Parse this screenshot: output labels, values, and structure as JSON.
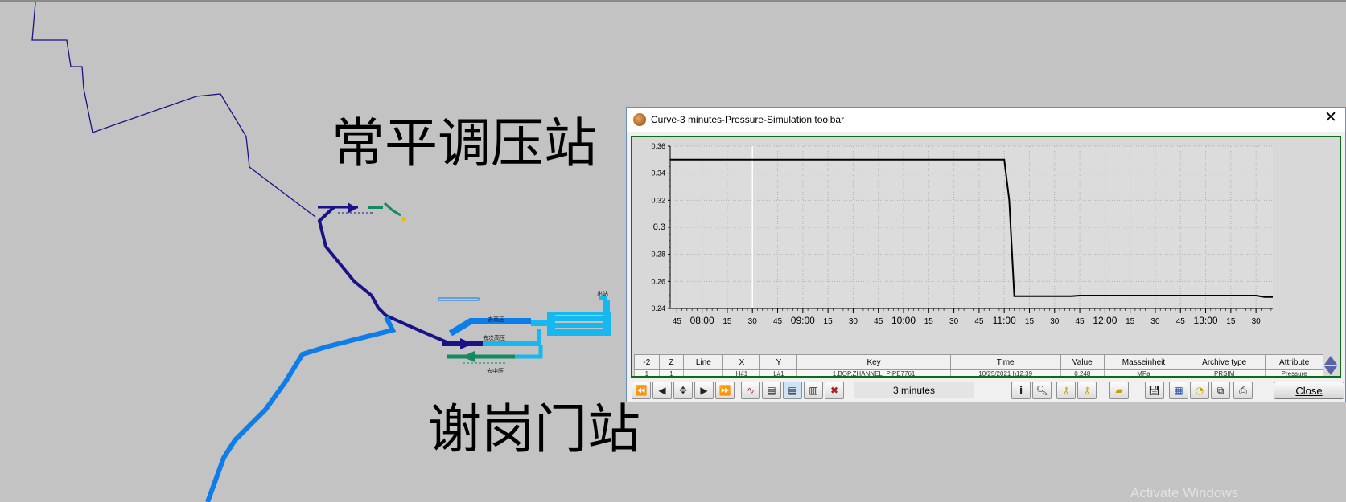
{
  "map": {
    "station_top": "常平调压站",
    "station_bottom": "谢岗门站",
    "small_labels": [
      "出站",
      "去高压",
      "去次高压",
      "去中压"
    ]
  },
  "window": {
    "title": "Curve-3 minutes-Pressure-Simulation toolbar",
    "close_glyph": "✕"
  },
  "chart_data": {
    "type": "line",
    "title": "",
    "xlabel": "",
    "ylabel": "",
    "x_ticks": [
      "45",
      "08:00",
      "15",
      "30",
      "45",
      "09:00",
      "15",
      "30",
      "45",
      "10:00",
      "15",
      "30",
      "45",
      "11:00",
      "15",
      "30",
      "45",
      "12:00",
      "15",
      "30",
      "45",
      "13:00",
      "15",
      "30"
    ],
    "y_ticks": [
      "0.36",
      "0.34",
      "0.32",
      "0.3",
      "0.28",
      "0.26",
      "0.24"
    ],
    "ylim": [
      0.24,
      0.36
    ],
    "xlim": [
      "07:41",
      "13:40"
    ],
    "grid": true,
    "series": [
      {
        "x": [
          "07:41",
          "11:00",
          "11:03",
          "11:06",
          "11:40",
          "11:45",
          "13:30",
          "13:35",
          "13:40"
        ],
        "y": [
          0.35,
          0.35,
          0.32,
          0.249,
          0.249,
          0.2495,
          0.2495,
          0.2485,
          0.2485
        ]
      }
    ],
    "color": "#000000"
  },
  "table": {
    "headers": [
      "-2",
      "Z",
      "Line",
      "X",
      "Y",
      "Key",
      "Time",
      "Value",
      "Masseinheit",
      "Archive type",
      "Attribute"
    ],
    "row": [
      "1",
      "1",
      "",
      "H#1",
      "L#1",
      "1.BOP.ZHANNEL_PIPE7761",
      "10/25/2021 h12:39",
      "0.248",
      "MPa",
      "PRSIM",
      "Pressure"
    ]
  },
  "toolbar": {
    "interval": "3 minutes",
    "close_label": "Close"
  },
  "watermark": "Activate Windows",
  "colors": {
    "pipe_navy": "#1a1287",
    "pipe_blue": "#0d7dea",
    "pipe_cyan": "#17b7ef",
    "pipe_green": "#138a62",
    "frame_green": "#0a6e16"
  }
}
